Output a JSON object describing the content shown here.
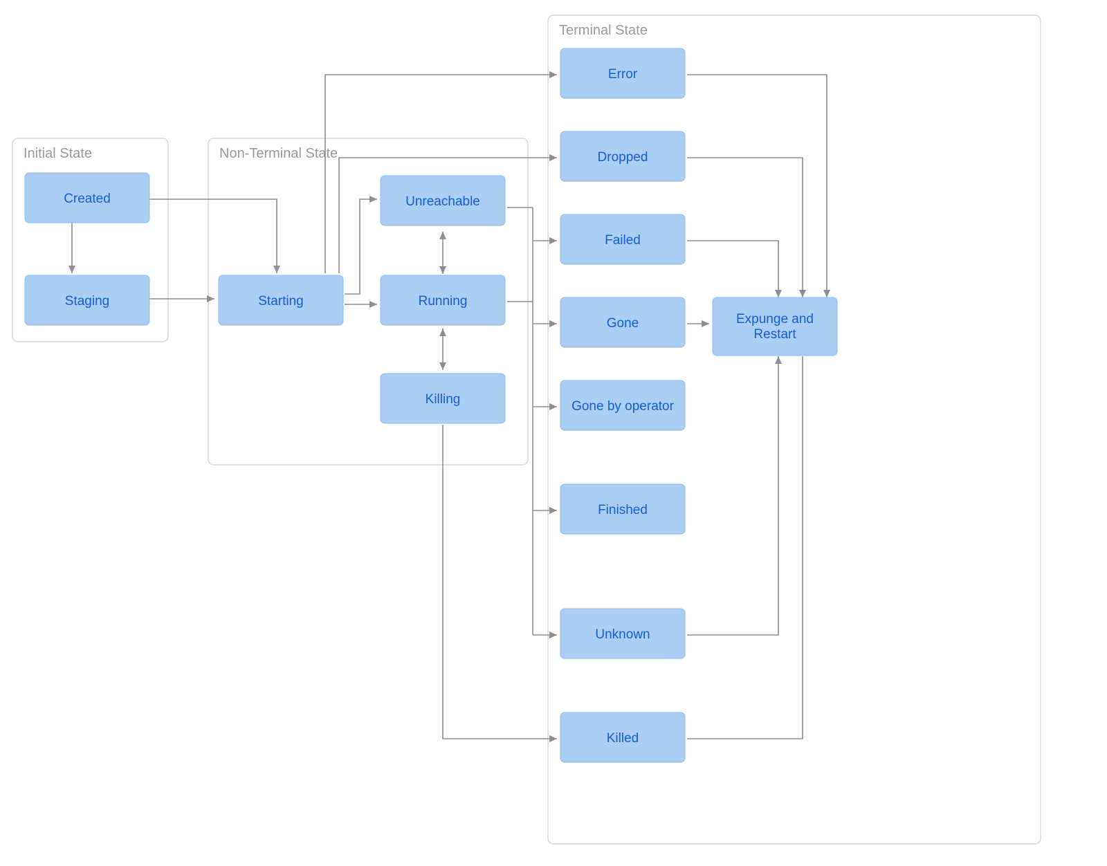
{
  "groups": {
    "initial": {
      "label": "Initial State"
    },
    "nonterm": {
      "label": "Non-Terminal State"
    },
    "terminal": {
      "label": "Terminal State"
    }
  },
  "nodes": {
    "created": {
      "label": "Created"
    },
    "staging": {
      "label": "Staging"
    },
    "starting": {
      "label": "Starting"
    },
    "unreachable": {
      "label": "Unreachable"
    },
    "running": {
      "label": "Running"
    },
    "killing": {
      "label": "Killing"
    },
    "error": {
      "label": "Error"
    },
    "dropped": {
      "label": "Dropped"
    },
    "failed": {
      "label": "Failed"
    },
    "gone": {
      "label": "Gone"
    },
    "gonebyop": {
      "label": "Gone by operator"
    },
    "finished": {
      "label": "Finished"
    },
    "unknown": {
      "label": "Unknown"
    },
    "killed": {
      "label": "Killed"
    },
    "expunge": {
      "label": "Expunge and Restart"
    }
  },
  "chart_data": {
    "type": "state-diagram",
    "groups": [
      {
        "id": "initial",
        "label": "Initial State",
        "nodes": [
          "created",
          "staging"
        ]
      },
      {
        "id": "nonterm",
        "label": "Non-Terminal State",
        "nodes": [
          "starting",
          "unreachable",
          "running",
          "killing"
        ]
      },
      {
        "id": "terminal",
        "label": "Terminal State",
        "nodes": [
          "error",
          "dropped",
          "failed",
          "gone",
          "gonebyop",
          "finished",
          "unknown",
          "killed",
          "expunge"
        ]
      }
    ],
    "edges": [
      {
        "from": "created",
        "to": "staging"
      },
      {
        "from": "created",
        "to": "starting"
      },
      {
        "from": "staging",
        "to": "starting"
      },
      {
        "from": "starting",
        "to": "error"
      },
      {
        "from": "starting",
        "to": "dropped"
      },
      {
        "from": "starting",
        "to": "unreachable"
      },
      {
        "from": "starting",
        "to": "running"
      },
      {
        "from": "running",
        "to": "unreachable",
        "bidir": true
      },
      {
        "from": "running",
        "to": "killing",
        "bidir": true
      },
      {
        "from": "running",
        "to": "failed"
      },
      {
        "from": "running",
        "to": "gone"
      },
      {
        "from": "running",
        "to": "gonebyop"
      },
      {
        "from": "running",
        "to": "finished"
      },
      {
        "from": "running",
        "to": "unknown"
      },
      {
        "from": "unreachable",
        "to": "gone"
      },
      {
        "from": "killing",
        "to": "killed"
      },
      {
        "from": "error",
        "to": "expunge"
      },
      {
        "from": "dropped",
        "to": "expunge"
      },
      {
        "from": "failed",
        "to": "expunge"
      },
      {
        "from": "gone",
        "to": "expunge"
      },
      {
        "from": "unknown",
        "to": "expunge"
      },
      {
        "from": "killed",
        "to": "expunge"
      }
    ]
  }
}
